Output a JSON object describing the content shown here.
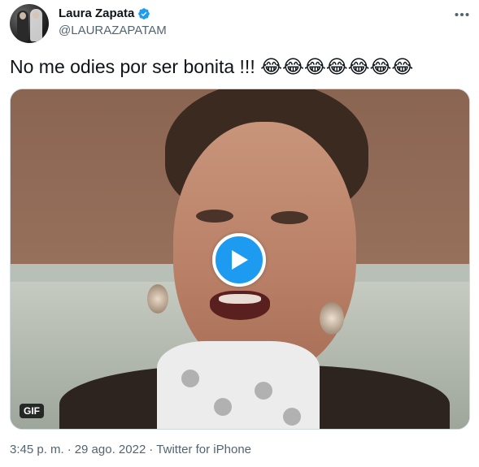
{
  "author": {
    "display_name": "Laura Zapata",
    "handle": "@LAURAZAPATAM",
    "verified": true
  },
  "tweet": {
    "text": "No me odies por ser bonita !!! 😂😂😂😂😂😂😂"
  },
  "media": {
    "type_badge": "GIF"
  },
  "footer": {
    "time": "3:45 p. m.",
    "separator": "·",
    "date": "29 ago. 2022",
    "source": "Twitter for iPhone"
  },
  "colors": {
    "accent": "#1d9bf0",
    "text_primary": "#0f1419",
    "text_secondary": "#536471",
    "border": "#cfd9de"
  },
  "icons": {
    "verified": "verified-badge-icon",
    "more": "more-options-icon",
    "play": "play-icon"
  }
}
